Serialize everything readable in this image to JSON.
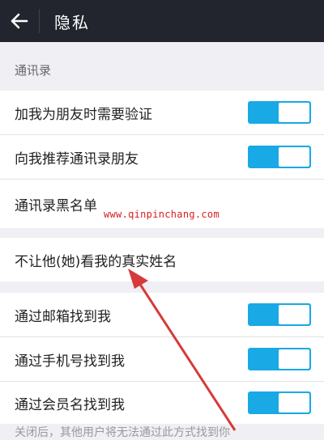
{
  "header": {
    "title": "隐私",
    "back_icon": "arrow-left-icon"
  },
  "contacts_section": {
    "label": "通讯录",
    "items": [
      {
        "label": "加我为朋友时需要验证",
        "toggle_on": true
      },
      {
        "label": "向我推荐通讯录朋友",
        "toggle_on": true
      },
      {
        "label": "通讯录黑名单"
      }
    ]
  },
  "real_name_item": {
    "label": "不让他(她)看我的真实姓名"
  },
  "find_me_section": {
    "items": [
      {
        "label": "通过邮箱找到我",
        "toggle_on": true
      },
      {
        "label": "通过手机号找到我",
        "toggle_on": true
      },
      {
        "label": "通过会员名找到我",
        "toggle_on": true
      }
    ]
  },
  "footer_hint": "关闭后，其他用户将无法通过此方式找到你",
  "watermark": "www.qinpinchang.com",
  "colors": {
    "header_bg": "#22252e",
    "toggle_on": "#19a9e5",
    "page_bg": "#efeff4",
    "arrow": "#d63a3a"
  }
}
